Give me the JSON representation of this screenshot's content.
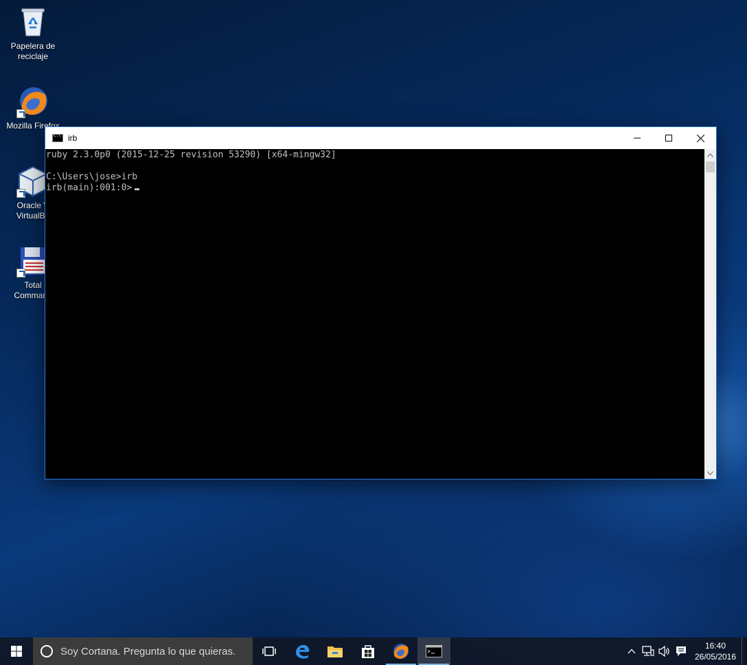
{
  "desktop": {
    "icons": [
      {
        "label_line1": "Papelera de",
        "label_line2": "reciclaje",
        "icon": "recycle-bin-icon"
      },
      {
        "label_line1": "Mozilla Firefox",
        "label_line2": "",
        "icon": "firefox-icon"
      },
      {
        "label_line1": "Oracle V",
        "label_line2": "VirtualBo",
        "icon": "virtualbox-icon"
      },
      {
        "label_line1": "Total",
        "label_line2": "Command",
        "icon": "total-commander-icon"
      }
    ]
  },
  "window": {
    "title": "irb",
    "console_lines": [
      "ruby 2.3.0p0 (2015-12-25 revision 53290) [x64-mingw32]",
      "",
      "C:\\Users\\jose>irb",
      "irb(main):001:0>"
    ]
  },
  "taskbar": {
    "cortana_placeholder": "Soy Cortana. Pregunta lo que quieras.",
    "apps": [
      {
        "name": "task-view",
        "icon": "task-view-icon"
      },
      {
        "name": "edge",
        "icon": "edge-icon"
      },
      {
        "name": "file-explorer",
        "icon": "folder-icon"
      },
      {
        "name": "store",
        "icon": "store-icon"
      },
      {
        "name": "firefox",
        "icon": "firefox-icon"
      },
      {
        "name": "command-prompt",
        "icon": "console-icon"
      }
    ],
    "clock": {
      "time": "16:40",
      "date": "26/05/2016"
    }
  },
  "colors": {
    "accent": "#2b79d8",
    "console_bg": "#000000",
    "console_fg": "#c0c0c0",
    "taskbar_indicator": "#76b9ed"
  }
}
